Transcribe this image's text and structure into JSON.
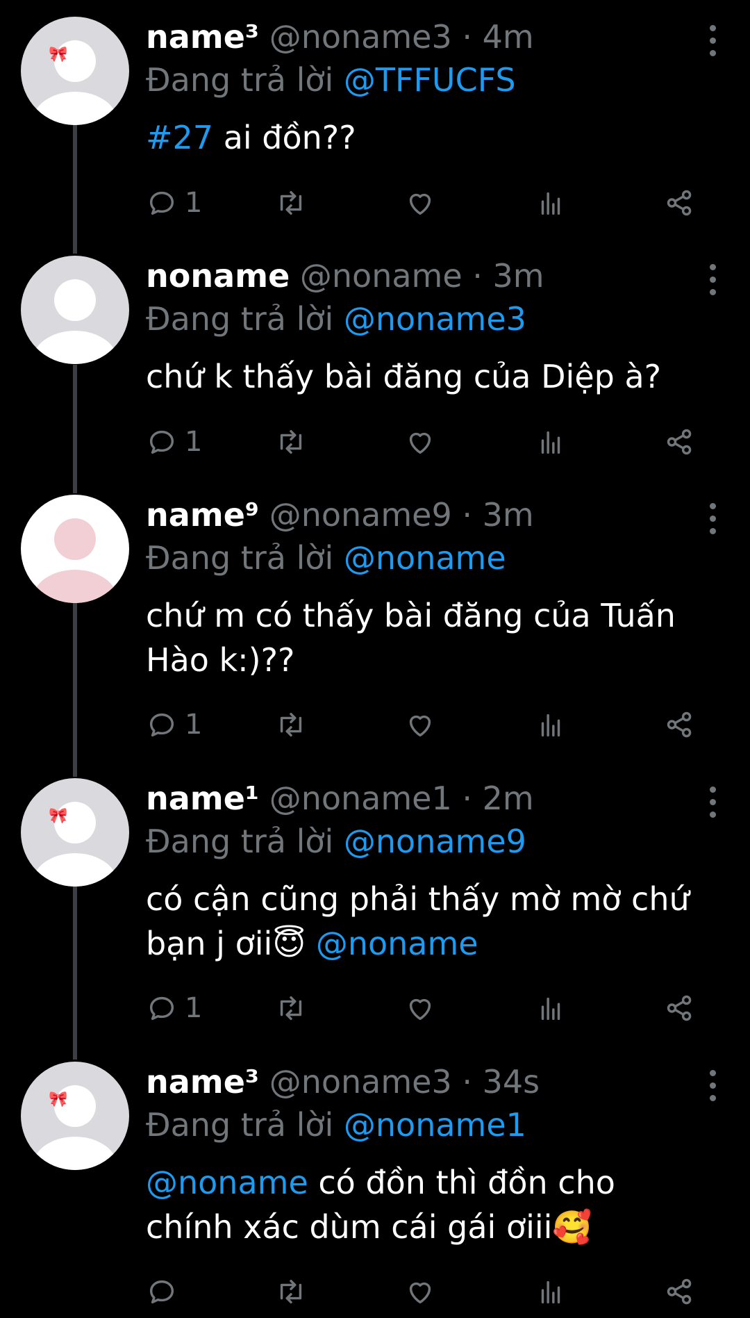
{
  "reply_prefix": "Đang trả lời",
  "tweets": [
    {
      "name": "name³",
      "handle_time": "@noname3 · 4m",
      "reply_to": "@TFFUCFS",
      "text_link": "#27",
      "text_main": " ai đồn??",
      "reply_count": "1"
    },
    {
      "name": "noname",
      "handle_time": "@noname · 3m",
      "reply_to": "@noname3",
      "text_main": "chứ k thấy bài đăng của Diệp à?",
      "reply_count": "1"
    },
    {
      "name": "name⁹",
      "handle_time": "@noname9 · 3m",
      "reply_to": "@noname",
      "text_line1": "chứ m có thấy bài đăng của Tuấn",
      "text_line2": "Hào k:)??",
      "reply_count": "1"
    },
    {
      "name": "name¹",
      "handle_time": "@noname1 · 2m",
      "reply_to": "@noname9",
      "text_line1": "có cận cũng phải thấy mờ mờ chứ",
      "text_line2": "bạn j ơii😇",
      "text_mention": " @noname",
      "reply_count": "1"
    },
    {
      "name": "name³",
      "handle_time": "@noname3 · 34s",
      "reply_to": "@noname1",
      "text_mention": "@noname",
      "text_line1": " có đồn thì đồn cho",
      "text_line2": "chính xác dùm cái gái ơiii🥰",
      "reply_count": ""
    }
  ],
  "icons": {
    "reply": "reply-icon",
    "retweet": "retweet-icon",
    "like": "like-icon",
    "views": "views-icon",
    "share": "share-icon",
    "more": "more-icon"
  },
  "colors": {
    "background": "#000000",
    "link": "#1d9bf0",
    "muted": "#71767b",
    "thread_line": "#3b3f44"
  }
}
